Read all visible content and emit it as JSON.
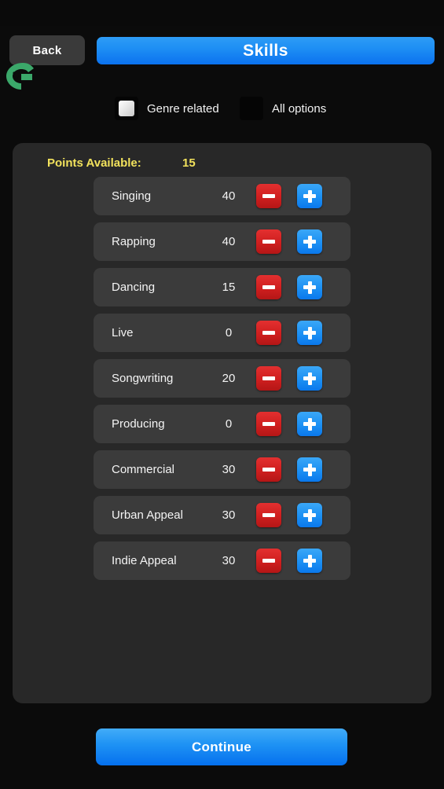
{
  "app": {
    "background_color": "#0b0b0b",
    "emulator_logo_icon": "android-emulator-logo-icon"
  },
  "header": {
    "back_label": "Back",
    "title": "Skills",
    "title_color": "#1f90f4"
  },
  "filters": {
    "options": [
      {
        "label": "Genre related",
        "checked": true
      },
      {
        "label": "All options",
        "checked": false
      }
    ]
  },
  "panel": {
    "points_label": "Points Available:",
    "points_value": "15",
    "points_color": "#f2e25c",
    "skills": [
      {
        "name": "Singing",
        "value": "40",
        "decrease_label": "minus-icon",
        "increase_label": "plus-icon"
      },
      {
        "name": "Rapping",
        "value": "40",
        "decrease_label": "minus-icon",
        "increase_label": "plus-icon"
      },
      {
        "name": "Dancing",
        "value": "15",
        "decrease_label": "minus-icon",
        "increase_label": "plus-icon"
      },
      {
        "name": "Live",
        "value": "0",
        "decrease_label": "minus-icon",
        "increase_label": "plus-icon"
      },
      {
        "name": "Songwriting",
        "value": "20",
        "decrease_label": "minus-icon",
        "increase_label": "plus-icon"
      },
      {
        "name": "Producing",
        "value": "0",
        "decrease_label": "minus-icon",
        "increase_label": "plus-icon"
      },
      {
        "name": "Commercial",
        "value": "30",
        "decrease_label": "minus-icon",
        "increase_label": "plus-icon"
      },
      {
        "name": "Urban Appeal",
        "value": "30",
        "decrease_label": "minus-icon",
        "increase_label": "plus-icon"
      },
      {
        "name": "Indie Appeal",
        "value": "30",
        "decrease_label": "minus-icon",
        "increase_label": "plus-icon"
      }
    ]
  },
  "footer": {
    "continue_label": "Continue",
    "accent_color": "#1f90f4"
  }
}
